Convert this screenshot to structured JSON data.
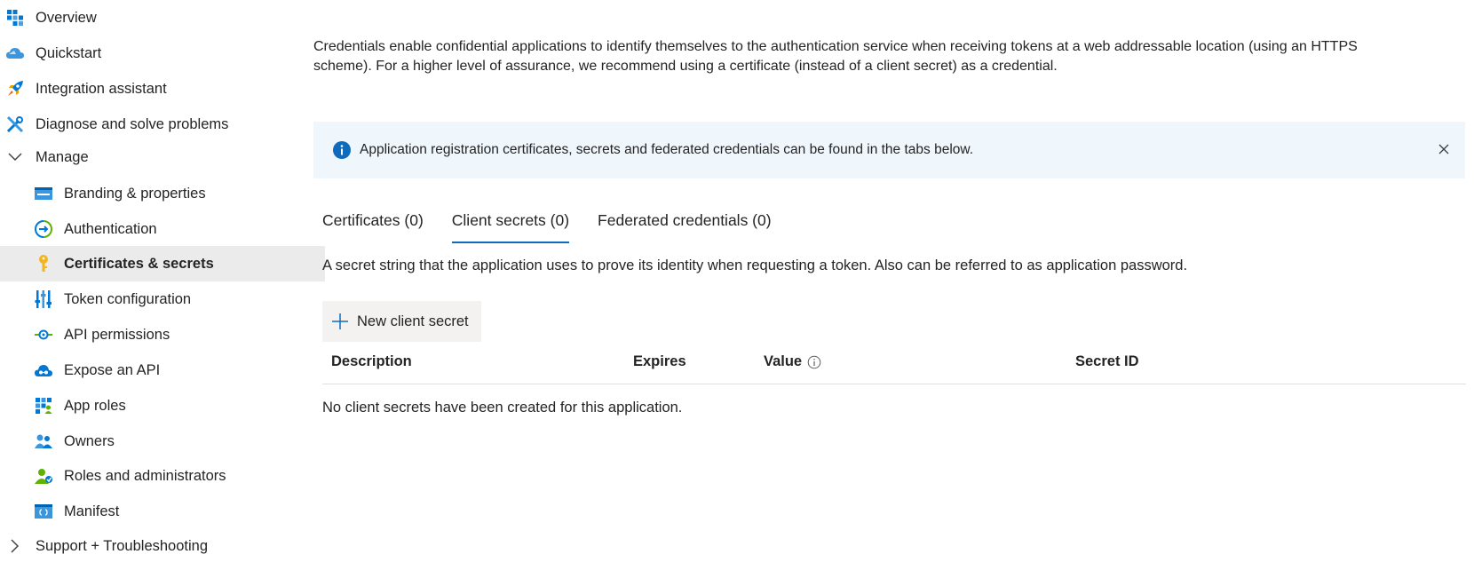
{
  "sidebar": {
    "overview": "Overview",
    "quickstart": "Quickstart",
    "integration": "Integration assistant",
    "diagnose": "Diagnose and solve problems",
    "manage": "Manage",
    "items": [
      {
        "label": "Branding & properties",
        "icon": "branding-icon"
      },
      {
        "label": "Authentication",
        "icon": "authentication-icon"
      },
      {
        "label": "Certificates & secrets",
        "icon": "key-icon"
      },
      {
        "label": "Token configuration",
        "icon": "token-config-icon"
      },
      {
        "label": "API permissions",
        "icon": "api-permissions-icon"
      },
      {
        "label": "Expose an API",
        "icon": "expose-api-icon"
      },
      {
        "label": "App roles",
        "icon": "app-roles-icon"
      },
      {
        "label": "Owners",
        "icon": "owners-icon"
      },
      {
        "label": "Roles and administrators",
        "icon": "roles-admins-icon"
      },
      {
        "label": "Manifest",
        "icon": "manifest-icon"
      }
    ],
    "support": "Support + Troubleshooting"
  },
  "main": {
    "intro_line1": "Credentials enable confidential applications to identify themselves to the authentication service when receiving tokens at a web addressable location (using an HTTPS",
    "intro_line2": "scheme). For a higher level of assurance, we recommend using a certificate (instead of a client secret) as a credential.",
    "banner": "Application registration certificates, secrets and federated credentials can be found in the tabs below.",
    "tabs": [
      {
        "label": "Certificates (0)"
      },
      {
        "label": "Client secrets (0)"
      },
      {
        "label": "Federated credentials (0)"
      }
    ],
    "active_tab": "Client secrets (0)",
    "description": "A secret string that the application uses to prove its identity when requesting a token. Also can be referred to as application password.",
    "new_button": "New client secret",
    "columns": {
      "description": "Description",
      "expires": "Expires",
      "value": "Value",
      "secret_id": "Secret ID"
    },
    "empty_message": "No client secrets have been created for this application."
  },
  "colors": {
    "accent": "#0f6cbd",
    "selected_bg": "#ebebeb",
    "banner_bg": "#eff6fc"
  }
}
